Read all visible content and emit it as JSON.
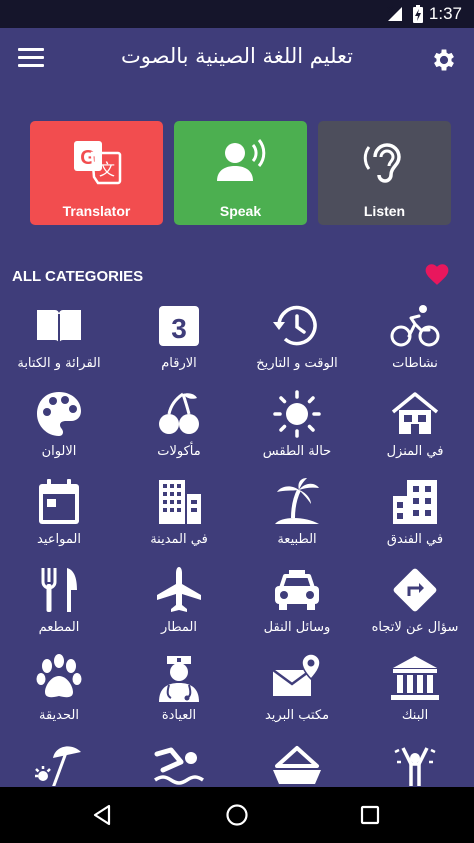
{
  "status_bar": {
    "time": "1:37",
    "icons": [
      "no-signal-icon",
      "battery-charging-icon"
    ]
  },
  "app_bar": {
    "title": "تعليم اللغة الصينية بالصوت",
    "menu_icon": "menu-icon",
    "settings_icon": "gear-icon"
  },
  "actions": [
    {
      "label": "Translator",
      "icon": "translate-icon",
      "color": "#f24d4f"
    },
    {
      "label": "Speak",
      "icon": "speaking-icon",
      "color": "#4caf50"
    },
    {
      "label": "Listen",
      "icon": "ear-icon",
      "color": "#4d4e5c"
    }
  ],
  "section": {
    "title": "ALL CATEGORIES",
    "favorite_icon": "heart-icon",
    "favorite_color": "#e8175d"
  },
  "categories": [
    {
      "label": "نشاطات",
      "icon": "bicycle-icon"
    },
    {
      "label": "الوقت و التاريخ",
      "icon": "history-clock-icon"
    },
    {
      "label": "الارقام",
      "icon": "number-three-icon"
    },
    {
      "label": "القرائة و الكتابة",
      "icon": "book-icon"
    },
    {
      "label": "في المنزل",
      "icon": "house-icon"
    },
    {
      "label": "حالة الطقس",
      "icon": "sun-icon"
    },
    {
      "label": "مأكولات",
      "icon": "cherries-icon"
    },
    {
      "label": "الالوان",
      "icon": "palette-icon"
    },
    {
      "label": "في الفندق",
      "icon": "hotel-building-icon"
    },
    {
      "label": "الطبيعة",
      "icon": "palm-island-icon"
    },
    {
      "label": "في المدينة",
      "icon": "city-buildings-icon"
    },
    {
      "label": "المواعيد",
      "icon": "calendar-icon"
    },
    {
      "label": "سؤال عن لاتجاه",
      "icon": "direction-sign-icon"
    },
    {
      "label": "وسائل النقل",
      "icon": "taxi-icon"
    },
    {
      "label": "المطار",
      "icon": "airplane-icon"
    },
    {
      "label": "المطعم",
      "icon": "fork-knife-icon"
    },
    {
      "label": "البنك",
      "icon": "bank-icon"
    },
    {
      "label": "مكتب البريد",
      "icon": "mail-location-icon"
    },
    {
      "label": "العيادة",
      "icon": "nurse-icon"
    },
    {
      "label": "الحديقة",
      "icon": "paw-icon"
    },
    {
      "label": "",
      "icon": "celebration-icon"
    },
    {
      "label": "",
      "icon": "boat-icon"
    },
    {
      "label": "",
      "icon": "swimmer-icon"
    },
    {
      "label": "",
      "icon": "beach-umbrella-icon"
    }
  ],
  "nav_bar": {
    "icons": [
      "back-icon",
      "home-icon",
      "recents-icon"
    ]
  }
}
